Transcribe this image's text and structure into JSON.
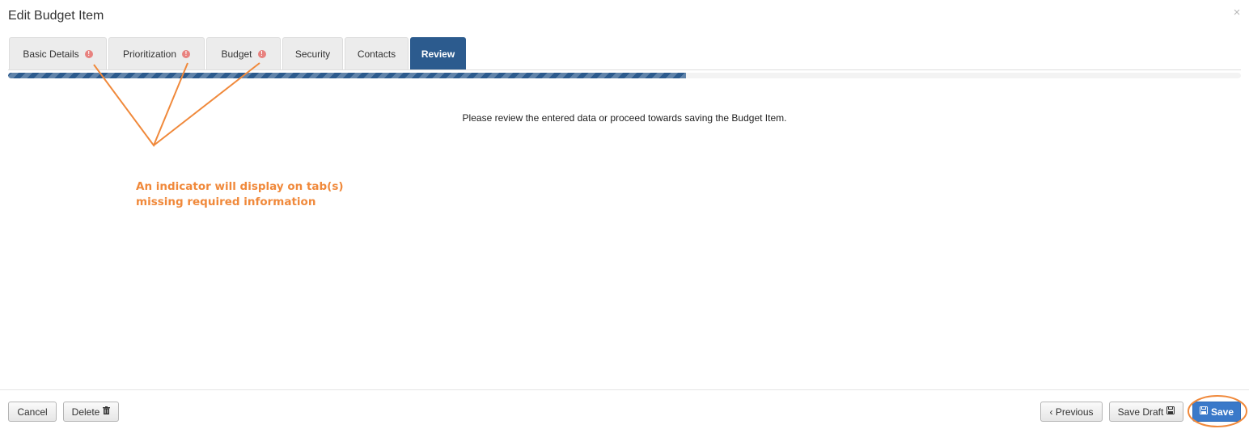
{
  "modal": {
    "title": "Edit Budget Item",
    "close_glyph": "×"
  },
  "tabs": [
    {
      "label": "Basic Details",
      "has_warning": true,
      "active": false
    },
    {
      "label": "Prioritization",
      "has_warning": true,
      "active": false
    },
    {
      "label": "Budget",
      "has_warning": true,
      "active": false
    },
    {
      "label": "Security",
      "has_warning": false,
      "active": false
    },
    {
      "label": "Contacts",
      "has_warning": false,
      "active": false
    },
    {
      "label": "Review",
      "has_warning": false,
      "active": true
    }
  ],
  "warning_glyph": "!",
  "progress": {
    "percent": 55
  },
  "review_message": "Please review the entered data or proceed towards saving the Budget Item.",
  "annotation": {
    "line1": "An indicator will display on tab(s)",
    "line2": "missing required information",
    "color": "#f0893b"
  },
  "footer": {
    "cancel_label": "Cancel",
    "delete_label": "Delete",
    "previous_label": "‹ Previous",
    "save_draft_label": "Save Draft",
    "save_label": "Save"
  },
  "colors": {
    "primary": "#2c5b8e",
    "save_button": "#3a79c9",
    "warning": "#e8827f"
  },
  "icons": {
    "delete": "trash-icon",
    "save_draft": "floppy-disk-icon",
    "save": "floppy-disk-icon"
  }
}
